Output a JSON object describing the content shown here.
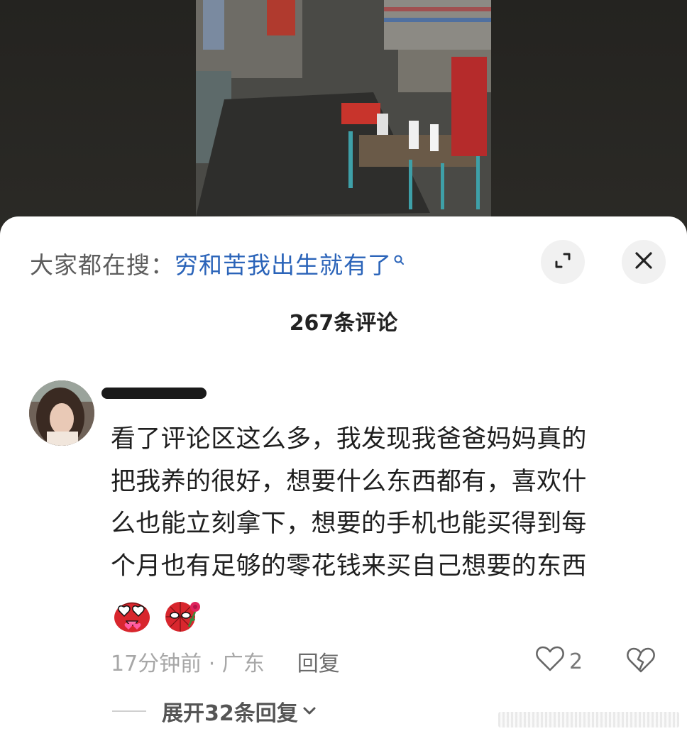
{
  "search": {
    "label": "大家都在搜：",
    "term": "穷和苦我出生就有了"
  },
  "comments_header": {
    "count_text": "267条评论"
  },
  "comment": {
    "lines": [
      "看了评论区这么多，我发现我爸爸妈妈真的",
      "把我养的很好，想要什么东西都有，喜欢什",
      "么也能立刻拿下，想要的手机也能买得到每",
      "个月也有足够的零花钱来买自己想要的东西"
    ],
    "emojis": [
      "spider-man-heart-eyes-emoji",
      "spider-man-face-with-rose-emoji"
    ],
    "time_location": "17分钟前 · 广东",
    "reply_label": "回复",
    "like_count": "2",
    "expand_label": "展开32条回复"
  },
  "icons": {
    "expand": "expand-icon",
    "close": "close-icon",
    "like": "heart-outline-icon",
    "dislike": "broken-heart-icon",
    "chevron": "chevron-down-icon"
  },
  "colors": {
    "search_term": "#2b64b9",
    "sheet_bg": "#ffffff",
    "backdrop": "#2a2925"
  }
}
